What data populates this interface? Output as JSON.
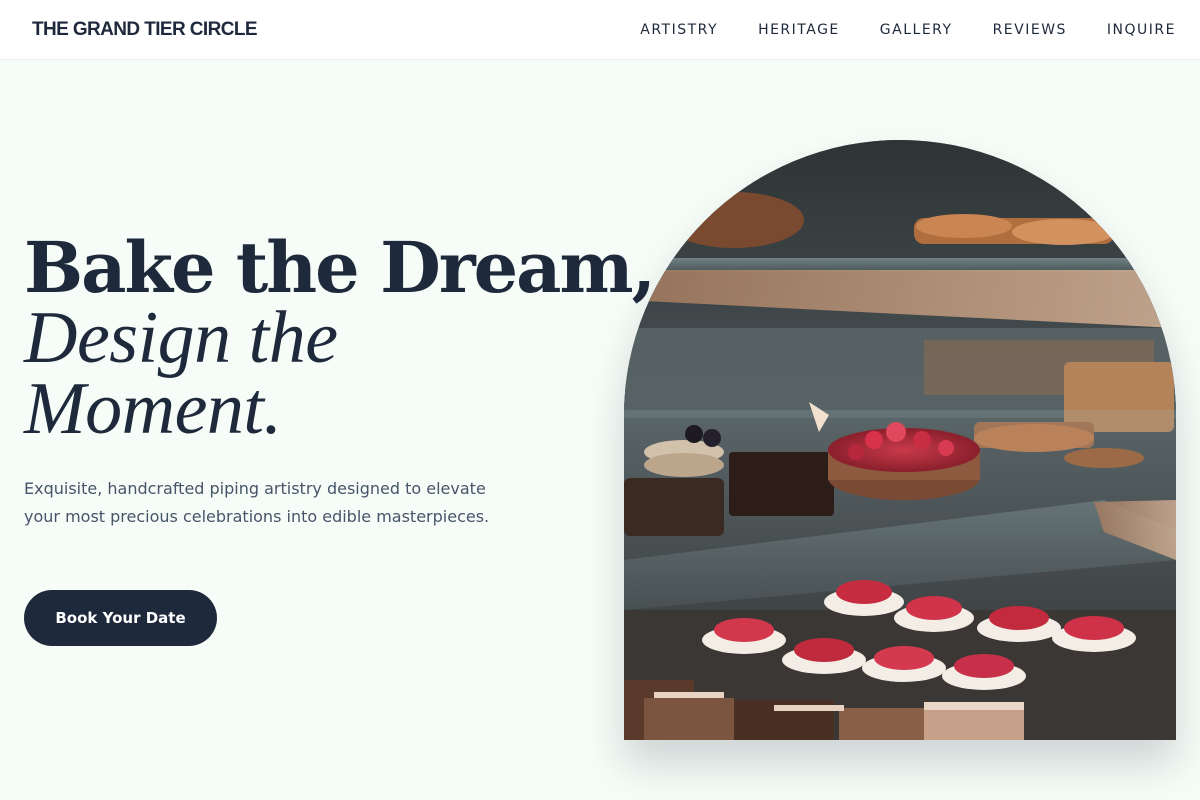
{
  "brand": {
    "name": "THE GRAND TIER CIRCLE"
  },
  "nav": {
    "items": [
      {
        "label": "ARTISTRY"
      },
      {
        "label": "HERITAGE"
      },
      {
        "label": "GALLERY"
      },
      {
        "label": "REVIEWS"
      },
      {
        "label": "INQUIRE"
      }
    ]
  },
  "hero": {
    "headline_line1": "Bake the Dream,",
    "headline_line2": "Design the",
    "headline_line3": "Moment.",
    "subtitle": "Exquisite, handcrafted piping artistry designed to elevate your most precious celebrations into edible masterpieces.",
    "cta_label": "Book Your Date",
    "image": {
      "subject": "pastry-display-case-photo"
    }
  },
  "colors": {
    "background": "#f6fcf7",
    "primary": "#1e293b",
    "text_muted": "#475569",
    "topbar": "#ffffff"
  }
}
